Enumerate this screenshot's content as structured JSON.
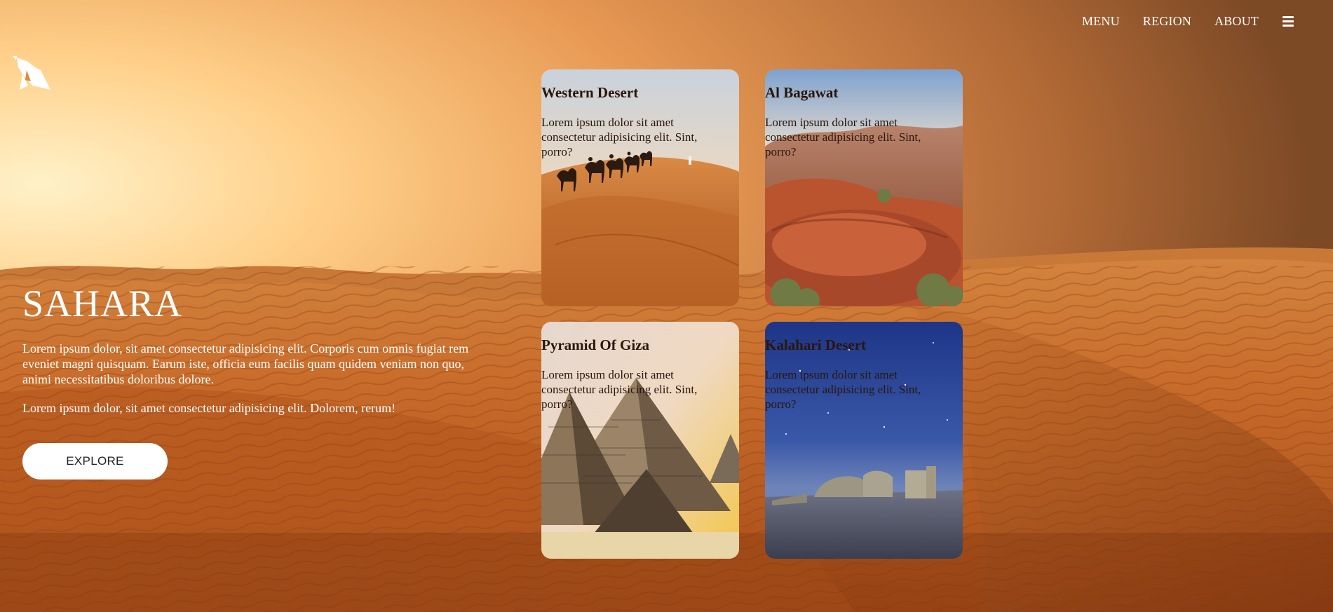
{
  "nav": {
    "items": [
      "MENU",
      "REGION",
      "ABOUT"
    ],
    "menu_icon": "hamburger-icon"
  },
  "logo": {
    "icon": "origami-bird-logo-icon"
  },
  "hero": {
    "title": "SAHARA",
    "paragraph1": "Lorem ipsum dolor, sit amet consectetur adipisicing elit. Corporis cum omnis fugiat rem eveniet magni quisquam. Earum iste, officia eum facilis quam quidem veniam non quo, animi necessitatibus doloribus dolore.",
    "paragraph2": "Lorem ipsum dolor, sit amet consectetur adipisicing elit. Dolorem, rerum!",
    "button_label": "EXPLORE"
  },
  "cards": [
    {
      "title": "Western Desert",
      "text": "Lorem ipsum dolor sit amet consectetur adipisicing elit. Sint, porro?",
      "image": "camel-caravan-dunes"
    },
    {
      "title": "Al Bagawat",
      "text": "Lorem ipsum dolor sit amet consectetur adipisicing elit. Sint, porro?",
      "image": "red-rock-canyon"
    },
    {
      "title": "Pyramid Of Giza",
      "text": "Lorem ipsum dolor sit amet consectetur adipisicing elit. Sint, porro?",
      "image": "giza-pyramids"
    },
    {
      "title": "Kalahari Desert",
      "text": "Lorem ipsum dolor sit amet consectetur adipisicing elit. Sint, porro?",
      "image": "night-sky-ruins"
    }
  ],
  "colors": {
    "sky_light": "#ffe2a8",
    "sky_orange": "#f4a65c",
    "sand": "#c7692a",
    "sand_dark": "#8a3c12",
    "card_text": "#2a160b"
  }
}
